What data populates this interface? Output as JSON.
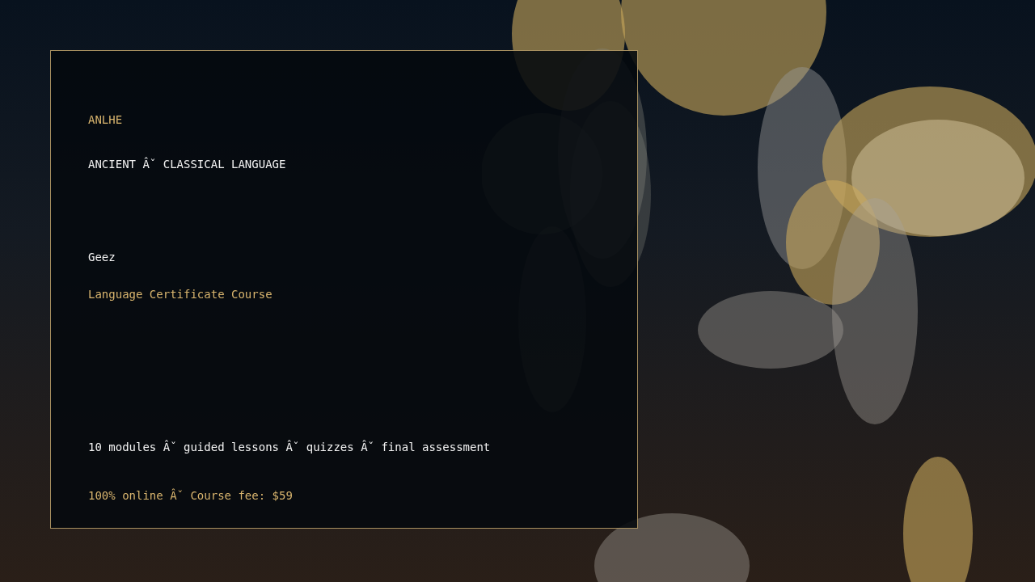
{
  "card": {
    "brand": "ANLHE",
    "category": "ANCIENT Âˇ CLASSICAL LANGUAGE",
    "language": "Geez",
    "course_type": "Language Certificate Course",
    "details": "10 modules Âˇ guided lessons Âˇ quizzes Âˇ final assessment",
    "pricing": "100% online Âˇ Course fee: $59"
  }
}
